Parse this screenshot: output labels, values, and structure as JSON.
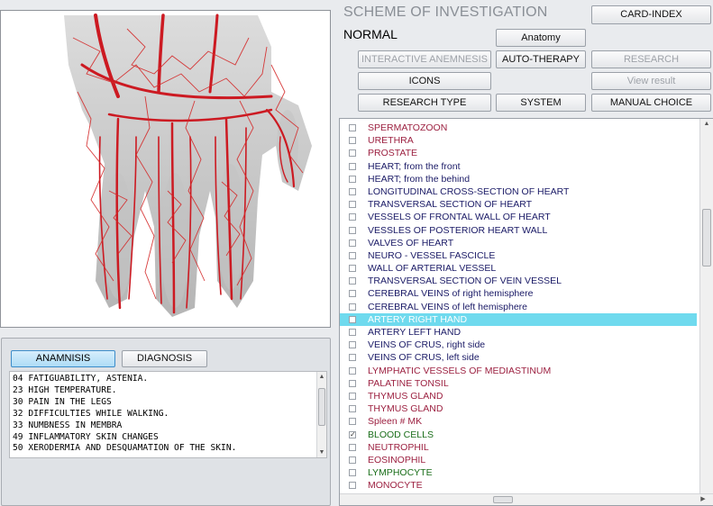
{
  "header": {
    "title": "SCHEME OF INVESTIGATION",
    "status": "NORMAL"
  },
  "buttons": {
    "card_index": "CARD-INDEX",
    "anatomy": "Anatomy",
    "interactive_anemnesis": "INTERACTIVE ANEMNESIS",
    "auto_therapy": "AUTO-THERAPY",
    "research": "RESEARCH",
    "icons": "ICONS",
    "view_result": "View result",
    "research_type": "RESEARCH TYPE",
    "system": "SYSTEM",
    "manual_choice": "MANUAL CHOICE"
  },
  "anamnesis_tabs": {
    "anamnesis": "ANAMNISIS",
    "diagnosis": "DIAGNOSIS"
  },
  "anamnesis_items": [
    "04 FATIGUABILITY, ASTENIA.",
    "23 HIGH TEMPERATURE.",
    "30 PAIN IN THE LEGS",
    "32 DIFFICULTIES WHILE WALKING.",
    "33 NUMBNESS IN MEMBRA",
    "49 INFLAMMATORY SKIN CHANGES",
    "50 XERODERMIA AND DESQUAMATION OF THE SKIN."
  ],
  "organ_list": [
    {
      "label": "SPERMATOZOON",
      "color": "#9c2040",
      "checked": false
    },
    {
      "label": "URETHRA",
      "color": "#9c2040",
      "checked": false
    },
    {
      "label": "PROSTATE",
      "color": "#9c2040",
      "checked": false
    },
    {
      "label": "HEART;  from the front",
      "color": "#1a1a66",
      "checked": false
    },
    {
      "label": "HEART;  from the behind",
      "color": "#1a1a66",
      "checked": false
    },
    {
      "label": "LONGITUDINAL CROSS-SECTION OF HEART",
      "color": "#1a1a66",
      "checked": false
    },
    {
      "label": "TRANSVERSAL SECTION OF HEART",
      "color": "#1a1a66",
      "checked": false
    },
    {
      "label": "VESSELS OF FRONTAL WALL OF HEART",
      "color": "#1a1a66",
      "checked": false
    },
    {
      "label": "VESSLES OF POSTERIOR HEART WALL",
      "color": "#1a1a66",
      "checked": false
    },
    {
      "label": "VALVES OF HEART",
      "color": "#1a1a66",
      "checked": false
    },
    {
      "label": "NEURO - VESSEL  FASCICLE",
      "color": "#1a1a66",
      "checked": false
    },
    {
      "label": "WALL OF ARTERIAL VESSEL",
      "color": "#1a1a66",
      "checked": false
    },
    {
      "label": "TRANSVERSAL SECTION OF VEIN VESSEL",
      "color": "#1a1a66",
      "checked": false
    },
    {
      "label": "CEREBRAL VEINS of right hemisphere",
      "color": "#1a1a66",
      "checked": false
    },
    {
      "label": "CEREBRAL VEINS of left hemisphere",
      "color": "#1a1a66",
      "checked": false
    },
    {
      "label": "ARTERY RIGHT HAND",
      "color": "#ffffff",
      "checked": false,
      "selected": true
    },
    {
      "label": "ARTERY LEFT HAND",
      "color": "#1a1a66",
      "checked": false
    },
    {
      "label": "VEINS OF CRUS, right side",
      "color": "#1a1a66",
      "checked": false
    },
    {
      "label": "VEINS OF CRUS, left side",
      "color": "#1a1a66",
      "checked": false
    },
    {
      "label": "LYMPHATIC VESSELS OF MEDIASTINUM",
      "color": "#9c2040",
      "checked": false
    },
    {
      "label": "PALATINE TONSIL",
      "color": "#9c2040",
      "checked": false
    },
    {
      "label": "THYMUS GLAND",
      "color": "#9c2040",
      "checked": false
    },
    {
      "label": "THYMUS GLAND",
      "color": "#9c2040",
      "checked": false
    },
    {
      "label": "Spleen # MK",
      "color": "#9c2040",
      "checked": false
    },
    {
      "label": "BLOOD  CELLS",
      "color": "#1a6e1a",
      "checked": true
    },
    {
      "label": "NEUTROPHIL",
      "color": "#9c2040",
      "checked": false
    },
    {
      "label": "EOSINOPHIL",
      "color": "#9c2040",
      "checked": false
    },
    {
      "label": "LYMPHOCYTE",
      "color": "#1a6e1a",
      "checked": false
    },
    {
      "label": "MONOCYTE",
      "color": "#9c2040",
      "checked": false
    }
  ],
  "colors": {
    "selection": "#6fdaee",
    "vessel_red": "#cc1a22"
  },
  "image": {
    "icon": "hand-arteries-illustration"
  }
}
